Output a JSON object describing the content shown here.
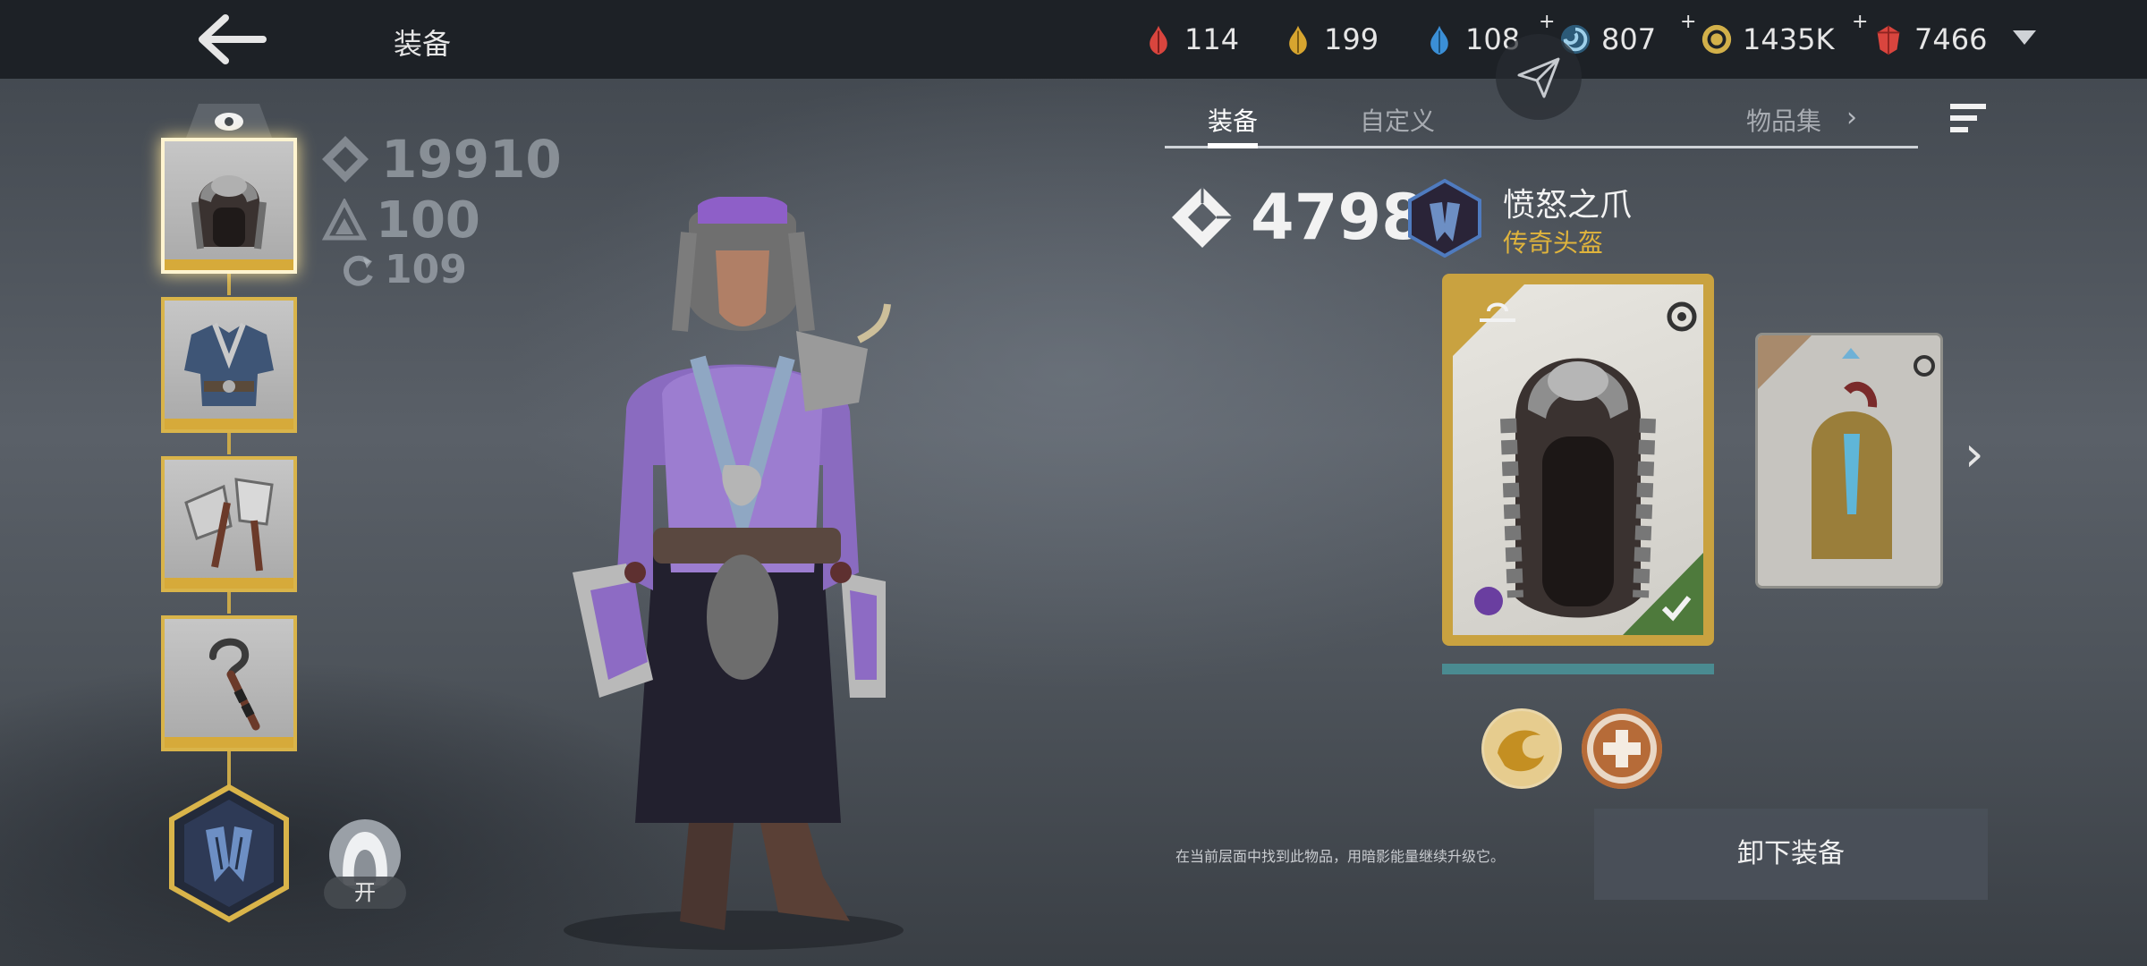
{
  "header": {
    "title": "装备",
    "resources": [
      {
        "icon": "red-shard-icon",
        "value": "114",
        "color": "#d9453e",
        "plus": ""
      },
      {
        "icon": "gold-shard-icon",
        "value": "199",
        "color": "#d7a52f",
        "plus": ""
      },
      {
        "icon": "blue-shard-icon",
        "value": "108",
        "color": "#3b8fd6",
        "plus": ""
      },
      {
        "icon": "swirl-orb-icon",
        "value": "807",
        "color": "#6fa8c9",
        "plus": "+"
      },
      {
        "icon": "coin-icon",
        "value": "1435K",
        "color": "#d2b04a",
        "plus": "+"
      },
      {
        "icon": "ruby-gem-icon",
        "value": "7466",
        "color": "#d9453e",
        "plus": "+"
      }
    ]
  },
  "stats": {
    "power_total": "19910",
    "level": "100",
    "cycle": "109"
  },
  "toggle": {
    "label": "开"
  },
  "tabs": [
    {
      "label": "装备",
      "active": true
    },
    {
      "label": "自定义",
      "active": false
    },
    {
      "label": "物品集",
      "active": false
    }
  ],
  "item": {
    "power": "4798",
    "name": "愤怒之爪",
    "rarity": "传奇头盔",
    "rarity_color": "#e0b43c"
  },
  "hint": "在当前层面中找到此物品，用暗影能量继续升级它。",
  "actions": {
    "unequip": "卸下装备"
  }
}
